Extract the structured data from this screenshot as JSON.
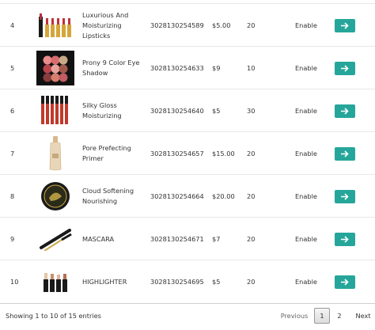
{
  "rows": [
    {
      "id": "4",
      "image": "lipsticks-thumbnail",
      "name": "Luxurious And Moisturizing Lipsticks",
      "sku": "3028130254589",
      "price": "$5.00",
      "qty": "20",
      "status": "Enable"
    },
    {
      "id": "5",
      "image": "eyeshadow-palette-thumbnail",
      "name": "Prony 9 Color Eye Shadow",
      "sku": "3028130254633",
      "price": "$9",
      "qty": "10",
      "status": "Enable"
    },
    {
      "id": "6",
      "image": "lip-gloss-thumbnail",
      "name": "Silky Gloss Moisturizing",
      "sku": "3028130254640",
      "price": "$5",
      "qty": "30",
      "status": "Enable"
    },
    {
      "id": "7",
      "image": "primer-bottle-thumbnail",
      "name": "Pore Prefecting Primer",
      "sku": "3028130254657",
      "price": "$15.00",
      "qty": "20",
      "status": "Enable"
    },
    {
      "id": "8",
      "image": "compact-powder-thumbnail",
      "name": "Cloud Softening Nourishing",
      "sku": "3028130254664",
      "price": "$20.00",
      "qty": "20",
      "status": "Enable"
    },
    {
      "id": "9",
      "image": "mascara-thumbnail",
      "name": "MASCARA",
      "sku": "3028130254671",
      "price": "$7",
      "qty": "20",
      "status": "Enable"
    },
    {
      "id": "10",
      "image": "highlighter-sticks-thumbnail",
      "name": "HIGHLIGHTER",
      "sku": "3028130254695",
      "price": "$5",
      "qty": "20",
      "status": "Enable"
    }
  ],
  "action_icon": "arrow-right-icon",
  "colors": {
    "accent": "#26a69a"
  },
  "footer": {
    "info": "Showing 1 to 10 of 15 entries",
    "previous": "Previous",
    "page1": "1",
    "page2": "2",
    "next": "Next"
  }
}
